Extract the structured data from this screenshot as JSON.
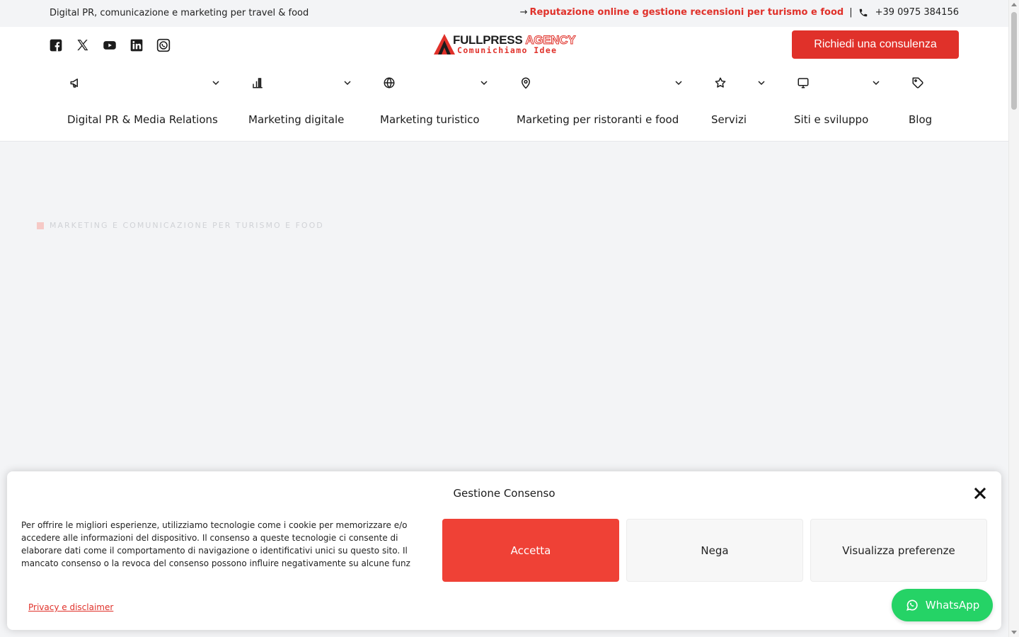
{
  "topbar": {
    "tagline": "Digital PR, comunicazione e marketing per travel & food",
    "arrow": "→",
    "promo_link": "Reputazione online e gestione recensioni per turismo e food",
    "separator": "|",
    "phone": "+39 0975 384156"
  },
  "header": {
    "socials": [
      "facebook-icon",
      "x-icon",
      "youtube-icon",
      "linkedin-icon",
      "whatsapp-icon"
    ],
    "logo": {
      "word_main": "FULLPRESS",
      "word_accent": "AGENCY",
      "subline": "Comunichiamo Idee"
    },
    "cta_label": "Richiedi una consulenza"
  },
  "menu": {
    "items": [
      {
        "label": "Digital PR & Media Relations",
        "icon": "megaphone-icon"
      },
      {
        "label": "Marketing digitale",
        "icon": "bar-chart-icon"
      },
      {
        "label": "Marketing turistico",
        "icon": "globe-icon"
      },
      {
        "label": "Marketing per ristoranti e food",
        "icon": "map-pin-icon"
      },
      {
        "label": "Servizi",
        "icon": "star-icon"
      },
      {
        "label": "Siti e sviluppo",
        "icon": "monitor-icon"
      },
      {
        "label": "Blog",
        "icon": "tag-icon"
      }
    ]
  },
  "hero": {
    "eyebrow": "MARKETING E COMUNICAZIONE PER TURISMO E FOOD"
  },
  "consent": {
    "title": "Gestione Consenso",
    "body": "Per offrire le migliori esperienze, utilizziamo tecnologie come i cookie per memorizzare e/o accedere alle informazioni del dispositivo. Il consenso a queste tecnologie ci consente di elaborare dati come il comportamento di navigazione o identificativi unici su questo sito. Il mancato consenso o la revoca del consenso possono influire negativamente su alcune funz",
    "accept_label": "Accetta",
    "deny_label": "Nega",
    "prefs_label": "Visualizza preferenze",
    "privacy_link": "Privacy e disclaimer"
  },
  "whatsapp": {
    "label": "WhatsApp"
  },
  "colors": {
    "brand_red": "#e0312a",
    "accept_red": "#ef4136",
    "whatsapp_green": "#25d366",
    "page_bg": "#f3f4f6"
  }
}
